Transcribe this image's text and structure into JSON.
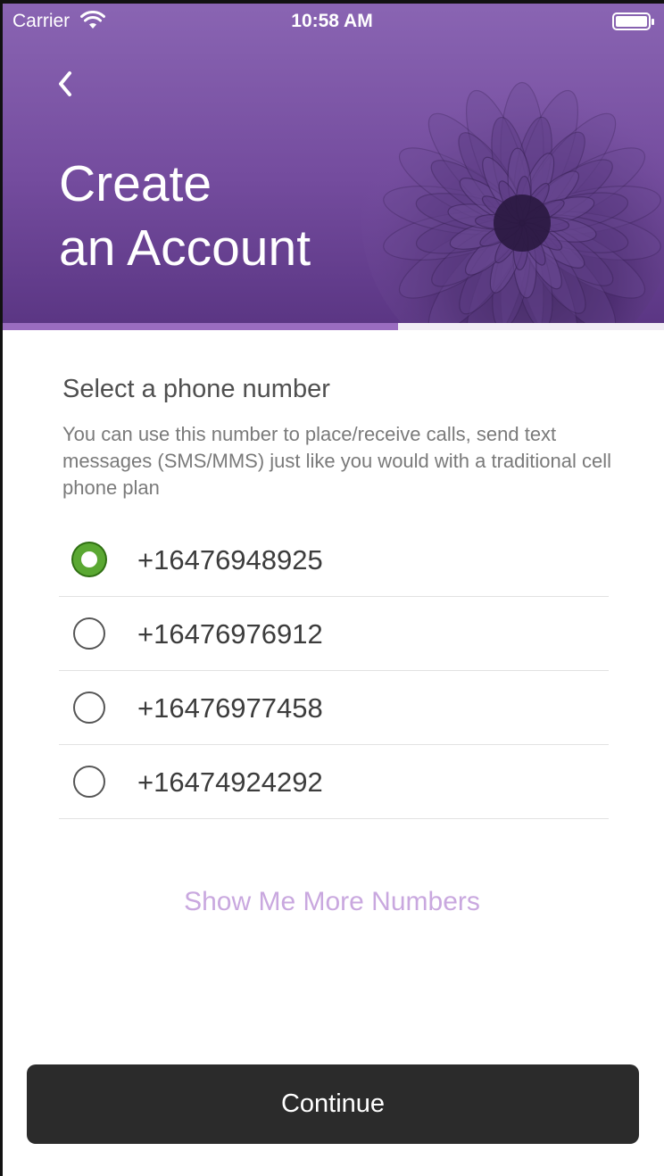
{
  "status_bar": {
    "carrier": "Carrier",
    "time": "10:58 AM"
  },
  "header": {
    "title_line1": "Create",
    "title_line2": "an Account",
    "background_color": "#744c9e",
    "back_icon": "chevron-left-icon"
  },
  "progress": {
    "fraction": 0.6,
    "fill_color": "#9a6cc0"
  },
  "section": {
    "title": "Select a phone number",
    "description": "You can use this number to place/receive calls, send text messages (SMS/MMS) just like you would with a traditional cell phone plan"
  },
  "numbers": [
    {
      "value": "+16476948925",
      "selected": true
    },
    {
      "value": "+16476976912",
      "selected": false
    },
    {
      "value": "+16476977458",
      "selected": false
    },
    {
      "value": "+16474924292",
      "selected": false
    }
  ],
  "more_link": "Show Me More Numbers",
  "continue_label": "Continue",
  "colors": {
    "accent": "#9a6cc0",
    "radio_selected": "#5aa832",
    "button": "#2b2b2b",
    "link": "#c9a8df"
  }
}
